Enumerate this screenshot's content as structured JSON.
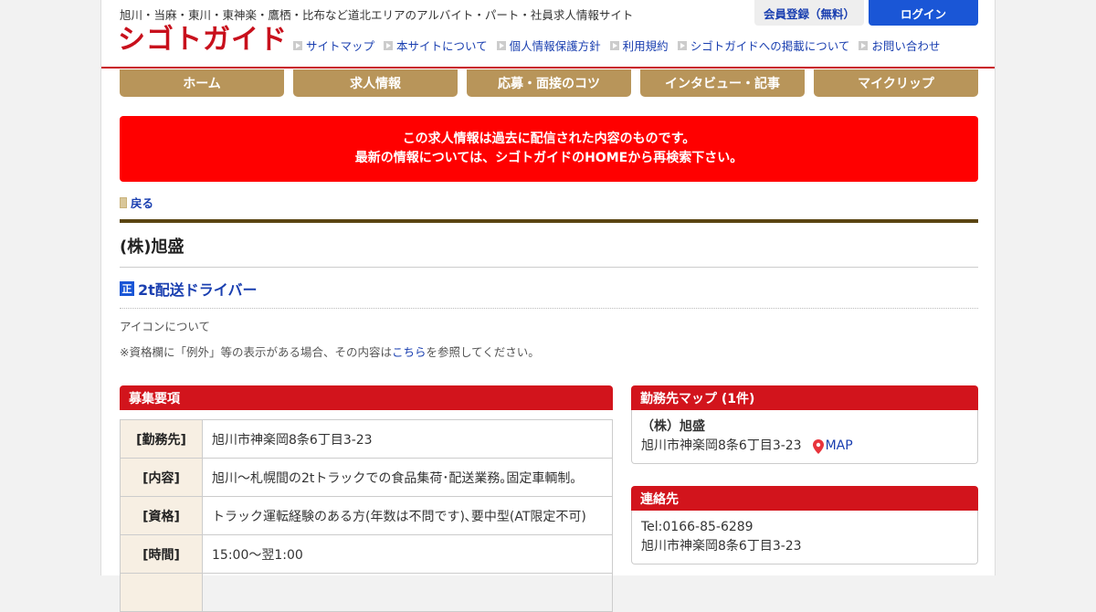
{
  "header": {
    "tagline": "旭川・当麻・東川・東神楽・鷹栖・比布など道北エリアのアルバイト・パート・社員求人情報サイト",
    "logo_text": "シゴトガイド",
    "utility_links": [
      "サイトマップ",
      "本サイトについて",
      "個人情報保護方針",
      "利用規約",
      "シゴトガイドへの掲載について",
      "お問い合わせ"
    ],
    "register_label": "会員登録（無料）",
    "login_label": "ログイン"
  },
  "gnav": [
    "ホーム",
    "求人情報",
    "応募・面接のコツ",
    "インタビュー・記事",
    "マイクリップ"
  ],
  "notice": {
    "line1": "この求人情報は過去に配信された内容のものです。",
    "line2": "最新の情報については、シゴトガイドのHOMEから再検索下さい。"
  },
  "back_label": "戻る",
  "company_name": "(株)旭盛",
  "job": {
    "badge": "正",
    "title": "2t配送ドライバー"
  },
  "icon_about": "アイコンについて",
  "qual_note": {
    "before": "※資格欄に「例外」等の表示がある場合、その内容は",
    "link": "こちら",
    "after": "を参照してください。"
  },
  "recruit": {
    "heading": "募集要項",
    "rows": [
      {
        "label": "[勤務先]",
        "value": "旭川市神楽岡8条6丁目3-23"
      },
      {
        "label": "[内容]",
        "value": "旭川〜札幌間の2tトラックでの食品集荷･配送業務｡固定車輌制｡"
      },
      {
        "label": "[資格]",
        "value": "トラック運転経験のある方(年数は不問です)､要中型(AT限定不可)"
      },
      {
        "label": "[時間]",
        "value": "15:00〜翌1:00"
      },
      {
        "label": "",
        "value": ""
      }
    ]
  },
  "map": {
    "heading": "勤務先マップ (1件)",
    "company": "（株）旭盛",
    "address": "旭川市神楽岡8条6丁目3-23",
    "map_label": "MAP"
  },
  "contact": {
    "heading": "連絡先",
    "tel": "Tel:0166-85-6289",
    "address": "旭川市神楽岡8条6丁目3-23"
  },
  "colors": {
    "brand_red": "#c8101c",
    "nav_gold": "#b8955a",
    "notice_red": "#ff0000",
    "link_blue": "#1a3fb0",
    "login_blue": "#1a56d6"
  }
}
